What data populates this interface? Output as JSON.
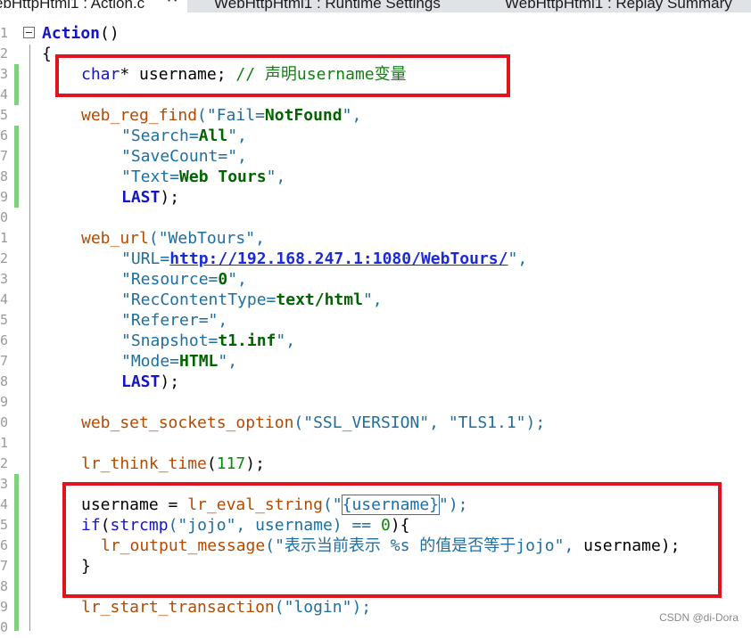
{
  "tabs": {
    "active": "ebHttpHtml1 : Action.c",
    "close_glyph": "✕",
    "t1": "WebHttpHtml1 : Runtime Settings",
    "t2": "WebHttpHtml1 : Replay Summary"
  },
  "line_numbers": [
    "1",
    "2",
    "3",
    "4",
    "5",
    "6",
    "7",
    "8",
    "9",
    "0",
    "1",
    "2",
    "3",
    "4",
    "5",
    "6",
    "7",
    "8",
    "9",
    "0",
    "1",
    "2",
    "3",
    "4",
    "5",
    "6",
    "7",
    "8",
    "9",
    "0"
  ],
  "code": {
    "l1_name": "Action",
    "l1_paren": "()",
    "l2": "{",
    "l3_kw": "char",
    "l3_rest": "* username; ",
    "l3_comment": "// 声明username变量",
    "l5_fn": "web_reg_find",
    "l5_q1": "(\"Fail=",
    "l5_val": "NotFound",
    "l5_end": "\",",
    "l6_key": "\"Search=",
    "l6_val": "All",
    "l6_end": "\",",
    "l7_key": "\"SaveCount=",
    "l7_end": "\",",
    "l8_key": "\"Text=",
    "l8_val": "Web Tours",
    "l8_end": "\",",
    "l9_last": "LAST",
    "l9_end": ");",
    "l11_fn": "web_url",
    "l11_arg": "(\"WebTours\",",
    "l12_key": "\"URL=",
    "l12_link": "http://192.168.247.1:1080/WebTours/",
    "l12_end": "\",",
    "l13_key": "\"Resource=",
    "l13_val": "0",
    "l13_end": "\",",
    "l14_key": "\"RecContentType=",
    "l14_val": "text/html",
    "l14_end": "\",",
    "l15_key": "\"Referer=",
    "l15_end": "\",",
    "l16_key": "\"Snapshot=",
    "l16_val": "t1.inf",
    "l16_end": "\",",
    "l17_key": "\"Mode=",
    "l17_val": "HTML",
    "l17_end": "\",",
    "l18_last": "LAST",
    "l18_end": ");",
    "l20_fn": "web_set_sockets_option",
    "l20_args": "(\"SSL_VERSION\", \"TLS1.1\");",
    "l22_fn": "lr_think_time",
    "l22_open": "(",
    "l22_num": "117",
    "l22_close": ");",
    "l24_var": "username = ",
    "l24_fn": "lr_eval_string",
    "l24_open": "(\"",
    "l24_param": "{username}",
    "l24_close": "\");",
    "l25_kw": "if",
    "l25_paren": "(",
    "l25_fn": "strcmp",
    "l25_args": "(\"jojo\", username) == ",
    "l25_num": "0",
    "l25_end": "){",
    "l26_fn": "lr_output_message",
    "l26_str": "(\"表示当前表示 %s 的值是否等于jojo\", ",
    "l26_end": "username);",
    "l27": "}",
    "l29_fn": "lr_start_transaction",
    "l29_args": "(\"login\");"
  },
  "watermark": "CSDN @di-Dora",
  "colors": {
    "annotation": "#e0141c",
    "change_bar": "#7fd07f",
    "keyword": "#1414c8",
    "function": "#b44a00",
    "string": "#1e6ea0",
    "comment": "#108010"
  }
}
